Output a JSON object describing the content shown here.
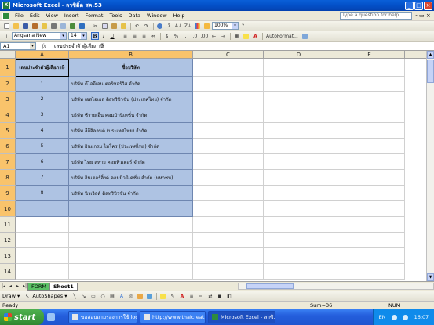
{
  "window": {
    "app_icon": "excel-icon",
    "title": "Microsoft Excel - ลาซิติ้ด สค.53"
  },
  "menu": {
    "items": [
      "File",
      "Edit",
      "View",
      "Insert",
      "Format",
      "Tools",
      "Data",
      "Window",
      "Help"
    ],
    "help_placeholder": "Type a question for help"
  },
  "toolbar": {
    "zoom": "100%",
    "font_name": "Angsana New",
    "font_size": "14",
    "autoformat_label": "AutoFormat..."
  },
  "formula_bar": {
    "cell_ref": "A1",
    "fx": "fx",
    "content": "เลขประจำตัวผู้เสียภาษี"
  },
  "sheet": {
    "columns": [
      "A",
      "B",
      "C",
      "D",
      "E"
    ],
    "row_numbers": [
      "1",
      "2",
      "3",
      "4",
      "5",
      "6",
      "7",
      "8",
      "9",
      "10",
      "11",
      "12",
      "13",
      "14"
    ],
    "header": [
      "เลขประจำตัวผู้เสียภาษี",
      "ชื่อบริษัท"
    ],
    "rows": [
      [
        "1",
        "บริษัท ดีไอจีเอนเตอร์ซอร์วิส จำกัด"
      ],
      [
        "2",
        "บริษัท เอสไอเอส ดิสทริบิวชั่น (ประเทศไทย) จำกัด"
      ],
      [
        "3",
        "บริษัท ซีวายเอ็น คอมมิวนิเคชั่น จำกัด"
      ],
      [
        "4",
        "บริษัท ลีจีจิลลนต์ (ประเทศไทย) จำกัด"
      ],
      [
        "5",
        "บริษัท อินแกรม ไมโคร (ประเทศไทย) จำกัด"
      ],
      [
        "6",
        "บริษัท ไทย สหาย คอมพิวเตอร์ จำกัด"
      ],
      [
        "7",
        "บริษัท อินเตอร์ลิ้งค์ คอมมิวนิเคชั่น จำกัด (มหาชน)"
      ],
      [
        "8",
        "บริษัท นิวเวิลด์ ดิสทริบิวชั่น จำกัด"
      ]
    ]
  },
  "tabs": {
    "items": [
      "FORM",
      "Sheet1"
    ]
  },
  "drawbar": {
    "draw_label": "Draw ▾",
    "autoshapes_label": "AutoShapes ▾"
  },
  "status": {
    "ready": "Ready",
    "sum": "Sum=36",
    "num": "NUM"
  },
  "taskbar": {
    "start": "start",
    "tasks": [
      "ขอสอบถามรองการใช้ look...",
      "http://www.thaicreat...",
      "Microsoft Excel - ลาซิ..."
    ],
    "lang": "EN",
    "clock": "16:07"
  },
  "colors": {
    "selected_fill": "#AEC3E3",
    "header_highlight": "#F9C36B",
    "sheet_tab_green": "#5BC066"
  }
}
